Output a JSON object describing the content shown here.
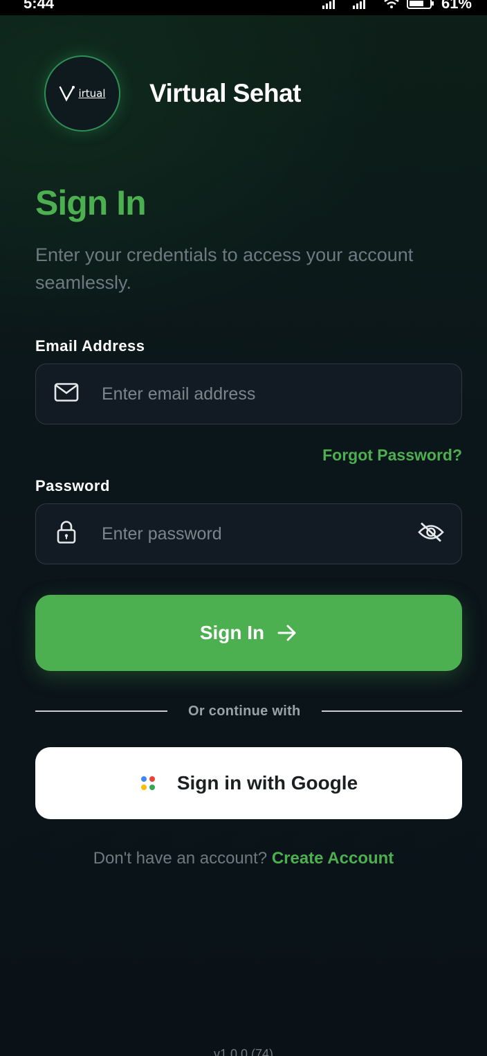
{
  "status_bar": {
    "time": "5:44",
    "battery": "61%"
  },
  "brand": {
    "logo_text": "irtual",
    "name": "Virtual Sehat"
  },
  "header": {
    "title": "Sign In",
    "subtitle": "Enter your credentials to access your account seamlessly."
  },
  "email": {
    "label": "Email Address",
    "placeholder": "Enter email address",
    "value": ""
  },
  "forgot_password": "Forgot Password?",
  "password": {
    "label": "Password",
    "placeholder": "Enter password",
    "value": ""
  },
  "signin_button": {
    "label": "Sign In",
    "icon": "arrow-right-icon"
  },
  "divider": {
    "label": "Or continue with"
  },
  "google_button": {
    "label": "Sign in with Google",
    "icon": "google-dots-icon"
  },
  "signup_prompt": {
    "question": "Don't have an account?",
    "link": "Create Account"
  },
  "version": "v1.0.0 (74)",
  "colors": {
    "accent": "#4caf50",
    "background": "#0b161a",
    "input_bg": "#121b24"
  }
}
